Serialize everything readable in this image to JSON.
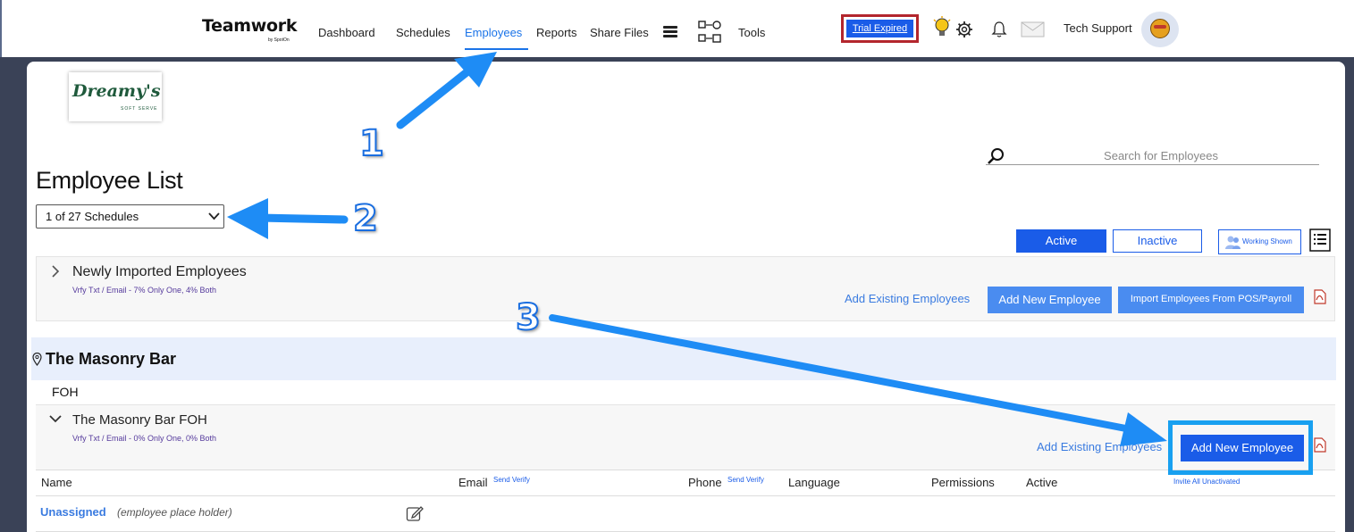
{
  "header": {
    "logo_text": "Teamwork",
    "logo_sub": "by SpotOn",
    "nav": [
      "Dashboard",
      "Schedules",
      "Employees",
      "Reports",
      "Share Files",
      "Tools"
    ],
    "active_nav": "Employees",
    "trial_label": "Trial Expired",
    "user_name": "Tech Support"
  },
  "brand": {
    "name": "Dreamy's",
    "tagline": "SOFT SERVE"
  },
  "search": {
    "placeholder": "Search for Employees"
  },
  "page": {
    "title": "Employee List",
    "schedule_select": "1 of 27 Schedules",
    "filter_active": "Active",
    "filter_inactive": "Inactive",
    "working_shown": "Working Shown"
  },
  "imported_group": {
    "title": "Newly Imported Employees",
    "subtitle": "Vrfy Txt / Email - 7% Only One, 4% Both",
    "add_existing": "Add Existing Employees",
    "add_new": "Add New Employee",
    "import_pos": "Import Employees From POS/Payroll"
  },
  "location": {
    "name": "The Masonry Bar",
    "section": "FOH"
  },
  "foh_group": {
    "title": "The Masonry Bar FOH",
    "subtitle": "Vrfy Txt / Email - 0% Only One, 0% Both",
    "add_existing": "Add Existing Employees",
    "add_new": "Add New Employee"
  },
  "table": {
    "columns": {
      "name": "Name",
      "email": "Email",
      "email_verify": "Send Verify",
      "phone": "Phone",
      "phone_verify": "Send Verify",
      "language": "Language",
      "permissions": "Permissions",
      "active": "Active",
      "invite": "Invite All Unactivated"
    },
    "rows": [
      {
        "name": "Unassigned",
        "note": "(employee place holder)"
      }
    ]
  },
  "annotations": {
    "step1": "1",
    "step2": "2",
    "step3": "3"
  },
  "colors": {
    "accent": "#1a5ce8",
    "annotation": "#1e8cf5",
    "trial_border": "#b3262d"
  }
}
